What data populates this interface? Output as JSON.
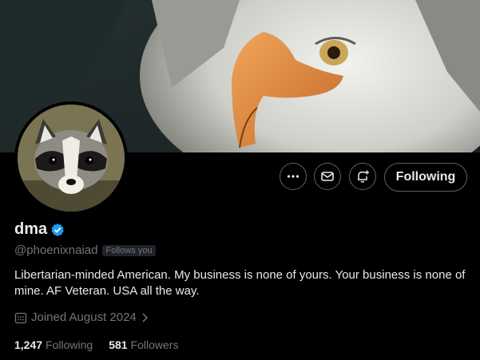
{
  "profile": {
    "display_name": "dma",
    "handle": "@phoenixnaiad",
    "follows_you": "Follows you",
    "bio": "Libertarian-minded American. My business is none of yours. Your business is none of mine. AF Veteran. USA all the way.",
    "joined": "Joined August 2024",
    "following_count": "1,247",
    "following_label": "Following",
    "followers_count": "581",
    "followers_label": "Followers"
  },
  "actions": {
    "more_icon": "more-icon",
    "message_icon": "mail-icon",
    "notify_icon": "bell-plus-icon",
    "follow_label": "Following"
  },
  "colors": {
    "background": "#000000",
    "verified": "#1d9bf0",
    "muted": "#71767b",
    "text": "#e7e9ea"
  }
}
